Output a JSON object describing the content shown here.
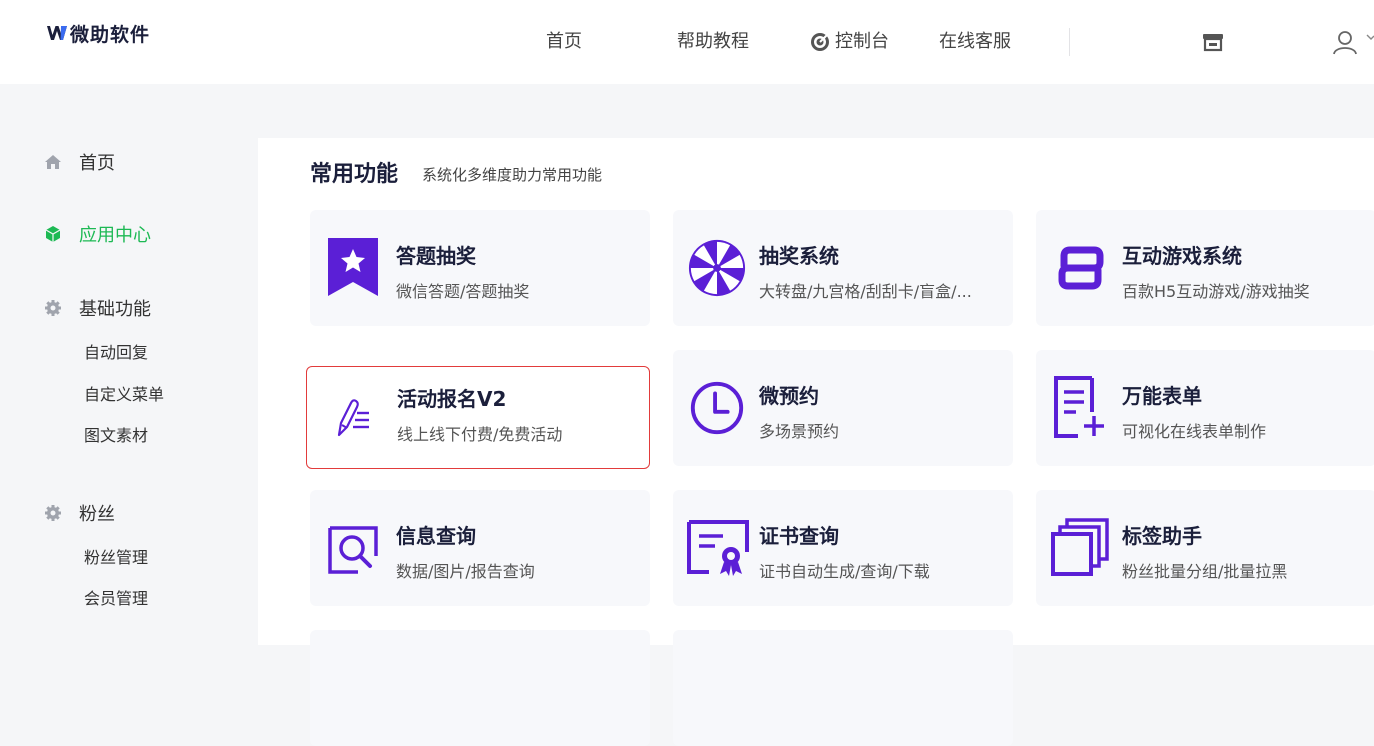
{
  "brand": {
    "name": "微助软件",
    "accent": "#5b1fd6"
  },
  "nav": {
    "items": [
      {
        "label": "首页"
      },
      {
        "label": "帮助教程"
      },
      {
        "label": "控制台",
        "icon": "target-icon"
      },
      {
        "label": "在线客服"
      }
    ],
    "icons": [
      "shop-icon",
      "user-icon"
    ]
  },
  "sidebar": {
    "groups": [
      {
        "label": "首页",
        "icon": "home-icon",
        "active": false,
        "subitems": []
      },
      {
        "label": "应用中心",
        "icon": "cube-icon",
        "active": true,
        "subitems": []
      },
      {
        "label": "基础功能",
        "icon": "gear-icon",
        "active": false,
        "subitems": [
          "自动回复",
          "自定义菜单",
          "图文素材"
        ]
      },
      {
        "label": "粉丝",
        "icon": "gear-icon",
        "active": false,
        "subitems": [
          "粉丝管理",
          "会员管理"
        ]
      }
    ],
    "active_color": "#1db954"
  },
  "main": {
    "section_title": "常用功能",
    "section_subtitle": "系统化多维度助力常用功能",
    "cards": [
      {
        "title": "答题抽奖",
        "desc": "微信答题/答题抽奖",
        "icon": "bookmark-star-icon"
      },
      {
        "title": "抽奖系统",
        "desc": "大转盘/九宫格/刮刮卡/盲盒/...",
        "icon": "wheel-icon"
      },
      {
        "title": "互动游戏系统",
        "desc": "百款H5互动游戏/游戏抽奖",
        "icon": "link-icon"
      },
      {
        "title": "活动报名V2",
        "desc": "线上线下付费/免费活动",
        "icon": "pen-list-icon",
        "selected": true
      },
      {
        "title": "微预约",
        "desc": "多场景预约",
        "icon": "clock-icon"
      },
      {
        "title": "万能表单",
        "desc": "可视化在线表单制作",
        "icon": "form-add-icon"
      },
      {
        "title": "信息查询",
        "desc": "数据/图片/报告查询",
        "icon": "search-doc-icon"
      },
      {
        "title": "证书查询",
        "desc": "证书自动生成/查询/下载",
        "icon": "certificate-icon"
      },
      {
        "title": "标签助手",
        "desc": "粉丝批量分组/批量拉黑",
        "icon": "layers-icon"
      }
    ]
  }
}
